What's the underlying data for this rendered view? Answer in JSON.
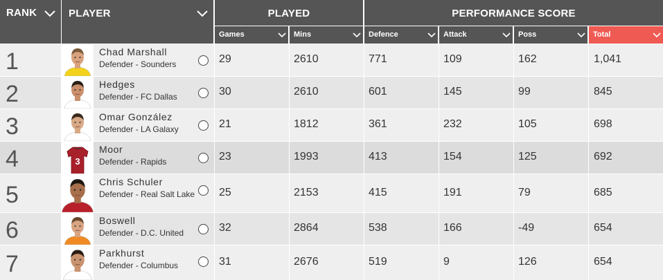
{
  "header": {
    "rank": "RANK",
    "player": "PLAYER",
    "played": "PLAYED",
    "performance": "PERFORMANCE SCORE",
    "games": "Games",
    "mins": "Mins",
    "defence": "Defence",
    "attack": "Attack",
    "poss": "Poss",
    "total": "Total"
  },
  "colors": {
    "header_bg": "#555555",
    "total_accent": "#ef5a52",
    "row_light": "#efefef",
    "row_dark": "#e5e5e5"
  },
  "rows": [
    {
      "rank": "1",
      "name": "Chad Marshall",
      "position": "Defender - Sounders",
      "games": "29",
      "mins": "2610",
      "defence": "771",
      "attack": "109",
      "poss": "162",
      "total": "1,041"
    },
    {
      "rank": "2",
      "name": "Hedges",
      "position": "Defender - FC Dallas",
      "games": "30",
      "mins": "2610",
      "defence": "601",
      "attack": "145",
      "poss": "99",
      "total": "845"
    },
    {
      "rank": "3",
      "name": "Omar González",
      "position": "Defender - LA Galaxy",
      "games": "21",
      "mins": "1812",
      "defence": "361",
      "attack": "232",
      "poss": "105",
      "total": "698"
    },
    {
      "rank": "4",
      "name": "Moor",
      "position": "Defender - Rapids",
      "games": "23",
      "mins": "1993",
      "defence": "413",
      "attack": "154",
      "poss": "125",
      "total": "692"
    },
    {
      "rank": "5",
      "name": "Chris Schuler",
      "position": "Defender - Real Salt Lake",
      "games": "25",
      "mins": "2153",
      "defence": "415",
      "attack": "191",
      "poss": "79",
      "total": "685"
    },
    {
      "rank": "6",
      "name": "Boswell",
      "position": "Defender - D.C. United",
      "games": "32",
      "mins": "2864",
      "defence": "538",
      "attack": "166",
      "poss": "-49",
      "total": "654"
    },
    {
      "rank": "7",
      "name": "Parkhurst",
      "position": "Defender - Columbus",
      "games": "31",
      "mins": "2676",
      "defence": "519",
      "attack": "9",
      "poss": "126",
      "total": "654"
    }
  ]
}
